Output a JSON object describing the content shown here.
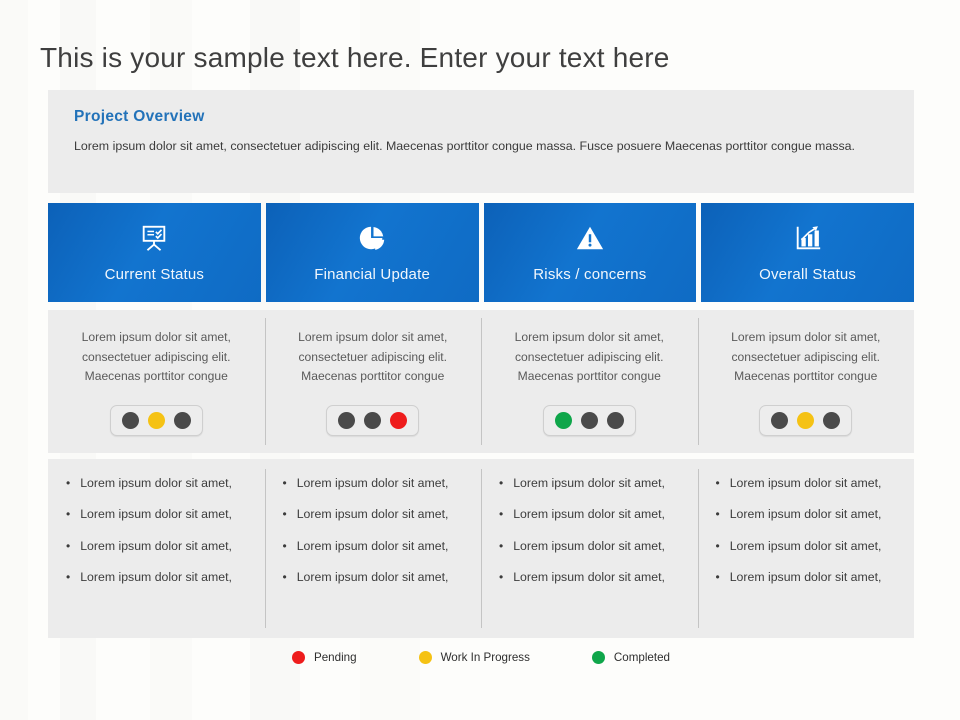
{
  "slide": {
    "title": "This is your sample text here. Enter your text here"
  },
  "overview": {
    "title": "Project Overview",
    "body": "Lorem ipsum dolor sit amet, consectetuer adipiscing elit. Maecenas porttitor congue massa. Fusce posuere Maecenas porttitor congue massa."
  },
  "colors": {
    "tile_blue": "#1274cf",
    "heading_blue": "#2272b9",
    "panel_gray": "#ececec",
    "pending_red": "#ee1c1c",
    "progress_yellow": "#f5c214",
    "completed_green": "#0fa64a",
    "inactive_gray": "#4a4a4a"
  },
  "columns": [
    {
      "icon": "presentation-board-icon",
      "label": "Current Status",
      "description": "Lorem ipsum dolor sit amet, consectetuer adipiscing elit. Maecenas porttitor congue",
      "lights": [
        "inactive",
        "progress",
        "inactive"
      ],
      "bullets": [
        "Lorem ipsum dolor sit amet,",
        "Lorem ipsum dolor sit amet,",
        "Lorem ipsum dolor sit amet,",
        "Lorem ipsum dolor sit amet,"
      ]
    },
    {
      "icon": "pie-chart-icon",
      "label": "Financial Update",
      "description": "Lorem ipsum dolor sit amet, consectetuer adipiscing elit. Maecenas porttitor congue",
      "lights": [
        "inactive",
        "inactive",
        "pending"
      ],
      "bullets": [
        "Lorem ipsum dolor sit amet,",
        "Lorem ipsum dolor sit amet,",
        "Lorem ipsum dolor sit amet,",
        "Lorem ipsum dolor sit amet,"
      ]
    },
    {
      "icon": "warning-triangle-icon",
      "label": "Risks / concerns",
      "description": "Lorem ipsum dolor sit amet, consectetuer adipiscing elit. Maecenas porttitor congue",
      "lights": [
        "completed",
        "inactive",
        "inactive"
      ],
      "bullets": [
        "Lorem ipsum dolor sit amet,",
        "Lorem ipsum dolor sit amet,",
        "Lorem ipsum dolor sit amet,",
        "Lorem ipsum dolor sit amet,"
      ]
    },
    {
      "icon": "bar-chart-icon",
      "label": "Overall Status",
      "description": "Lorem ipsum dolor sit amet, consectetuer adipiscing elit. Maecenas porttitor congue",
      "lights": [
        "inactive",
        "progress",
        "inactive"
      ],
      "bullets": [
        "Lorem ipsum dolor sit amet,",
        "Lorem ipsum dolor sit amet,",
        "Lorem ipsum dolor sit amet,",
        "Lorem ipsum dolor sit amet,"
      ]
    }
  ],
  "legend": [
    {
      "label": "Pending",
      "color": "#ee1c1c",
      "key": "pending"
    },
    {
      "label": "Work In Progress",
      "color": "#f5c214",
      "key": "progress"
    },
    {
      "label": "Completed",
      "color": "#0fa64a",
      "key": "completed"
    }
  ],
  "bullet_marker": "•"
}
